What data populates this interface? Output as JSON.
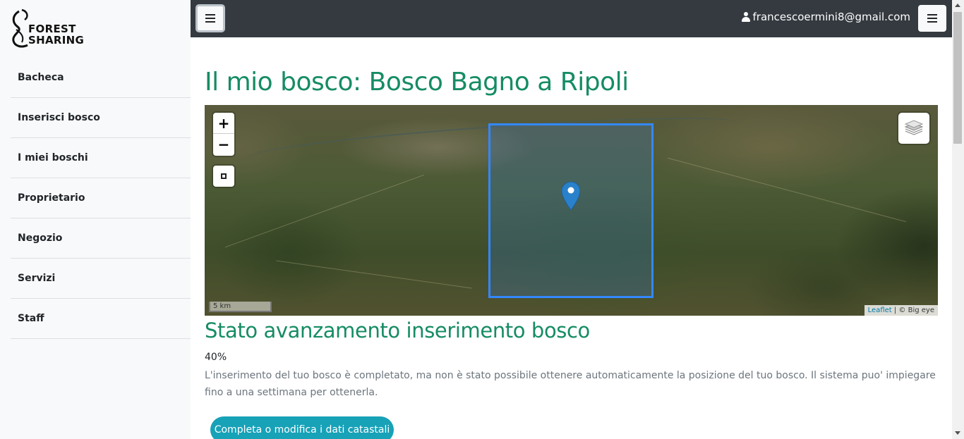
{
  "brand": {
    "logo_line1": "FOREST",
    "logo_line2": "SHARING"
  },
  "sidebar": {
    "items": [
      {
        "label": "Bacheca"
      },
      {
        "label": "Inserisci bosco"
      },
      {
        "label": "I miei boschi"
      },
      {
        "label": "Proprietario"
      },
      {
        "label": "Negozio"
      },
      {
        "label": "Servizi"
      },
      {
        "label": "Staff"
      }
    ]
  },
  "topbar": {
    "user_email": "francescoermini8@gmail.com"
  },
  "main": {
    "title": "Il mio bosco: Bosco Bagno a Ripoli",
    "map": {
      "zoom_in": "+",
      "zoom_out": "−",
      "scale_label": "5 km",
      "attribution_link": "Leaflet",
      "attribution_text": " | © Big eye"
    },
    "progress": {
      "title": "Stato avanzamento inserimento bosco",
      "percent_text": "40%",
      "percent_value": 40,
      "description": "L'inserimento del tuo bosco è completato, ma non è stato possibile ottenere automaticamente la posizione del tuo bosco. Il sistema puo' impiegare fino a una settimana per ottenerla."
    },
    "cta_label": "Completa o modifica i dati catastali"
  },
  "colors": {
    "title_green": "#168c63",
    "topbar_dark": "#343a40",
    "cta_teal": "#17a2b8",
    "bbox_blue": "#3388ff",
    "marker_blue": "#2a81cb"
  },
  "icons": {
    "menu_left": "hamburger-icon",
    "menu_right": "hamburger-icon",
    "user": "user-icon",
    "layers": "layers-icon",
    "marker": "map-marker-icon",
    "draw": "draw-rectangle-icon"
  }
}
